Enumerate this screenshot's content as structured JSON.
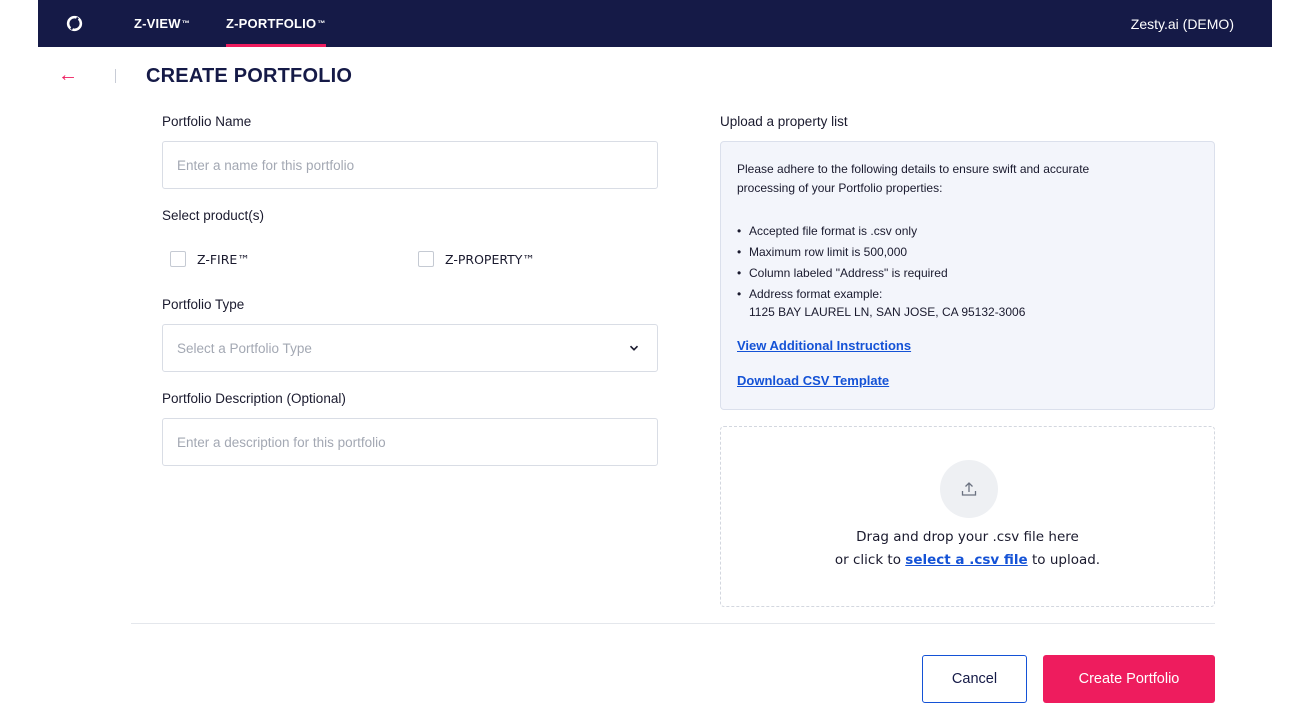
{
  "nav": {
    "tabs": [
      {
        "label": "Z-VIEW",
        "tm": "™"
      },
      {
        "label": "Z-PORTFOLIO",
        "tm": "™"
      }
    ],
    "account": "Zesty.ai (DEMO)"
  },
  "header": {
    "title": "CREATE PORTFOLIO"
  },
  "form": {
    "name_label": "Portfolio Name",
    "name_placeholder": "Enter a name for this portfolio",
    "products_label": "Select product(s)",
    "products": [
      {
        "label": "Z-FIRE™"
      },
      {
        "label": "Z-PROPERTY™"
      }
    ],
    "type_label": "Portfolio Type",
    "type_placeholder": "Select a Portfolio Type",
    "desc_label": "Portfolio Description (Optional)",
    "desc_placeholder": "Enter a description for this portfolio"
  },
  "upload": {
    "label": "Upload a property list",
    "intro_line1": "Please adhere to the following details to ensure swift and accurate",
    "intro_line2": "processing of your Portfolio properties:",
    "bullets": [
      "Accepted file format is .csv only",
      "Maximum row limit is 500,000",
      "Column labeled \"Address\" is required",
      "Address format example:"
    ],
    "address_example": "1125 BAY LAUREL LN, SAN JOSE, CA 95132-3006",
    "instructions_link": "View Additional Instructions",
    "template_link": "Download CSV Template",
    "drop_line1": "Drag and drop your .csv file here",
    "drop_line2_prefix": "or click to",
    "drop_link": "select a .csv file",
    "drop_line2_suffix": "to upload."
  },
  "actions": {
    "cancel": "Cancel",
    "create": "Create Portfolio"
  },
  "colors": {
    "navbar": "#151a47",
    "accent": "#ee1c5e",
    "link": "#1452d6",
    "info_bg": "#f3f5fb"
  }
}
